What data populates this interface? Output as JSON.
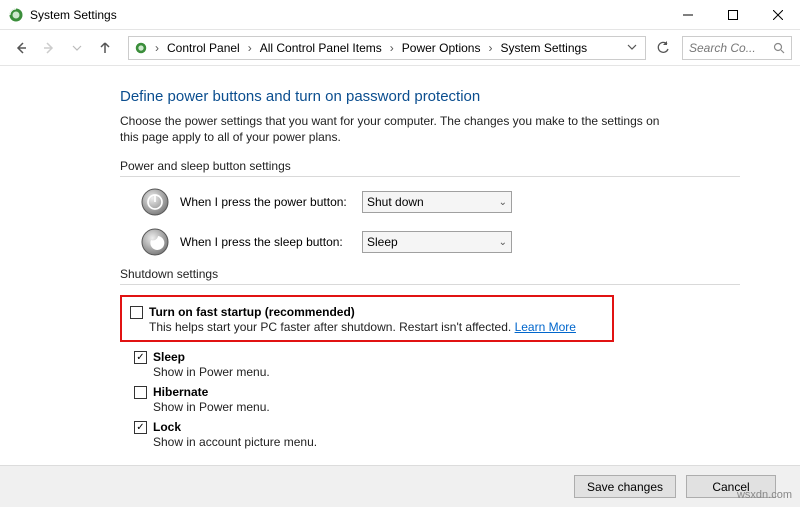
{
  "window": {
    "title": "System Settings"
  },
  "breadcrumb": {
    "items": [
      "Control Panel",
      "All Control Panel Items",
      "Power Options",
      "System Settings"
    ]
  },
  "search": {
    "placeholder": "Search Co..."
  },
  "page": {
    "title": "Define power buttons and turn on password protection",
    "intro": "Choose the power settings that you want for your computer. The changes you make to the settings on this page apply to all of your power plans."
  },
  "power_section": {
    "header": "Power and sleep button settings",
    "power_button_label": "When I press the power button:",
    "power_button_value": "Shut down",
    "sleep_button_label": "When I press the sleep button:",
    "sleep_button_value": "Sleep"
  },
  "shutdown_section": {
    "header": "Shutdown settings",
    "fast_startup": {
      "checked": false,
      "label": "Turn on fast startup (recommended)",
      "desc": "This helps start your PC faster after shutdown. Restart isn't affected. ",
      "learn_more": "Learn More"
    },
    "sleep": {
      "checked": true,
      "label": "Sleep",
      "desc": "Show in Power menu."
    },
    "hibernate": {
      "checked": false,
      "label": "Hibernate",
      "desc": "Show in Power menu."
    },
    "lock": {
      "checked": true,
      "label": "Lock",
      "desc": "Show in account picture menu."
    }
  },
  "footer": {
    "save": "Save changes",
    "cancel": "Cancel"
  },
  "watermark": "wsxdn.com"
}
